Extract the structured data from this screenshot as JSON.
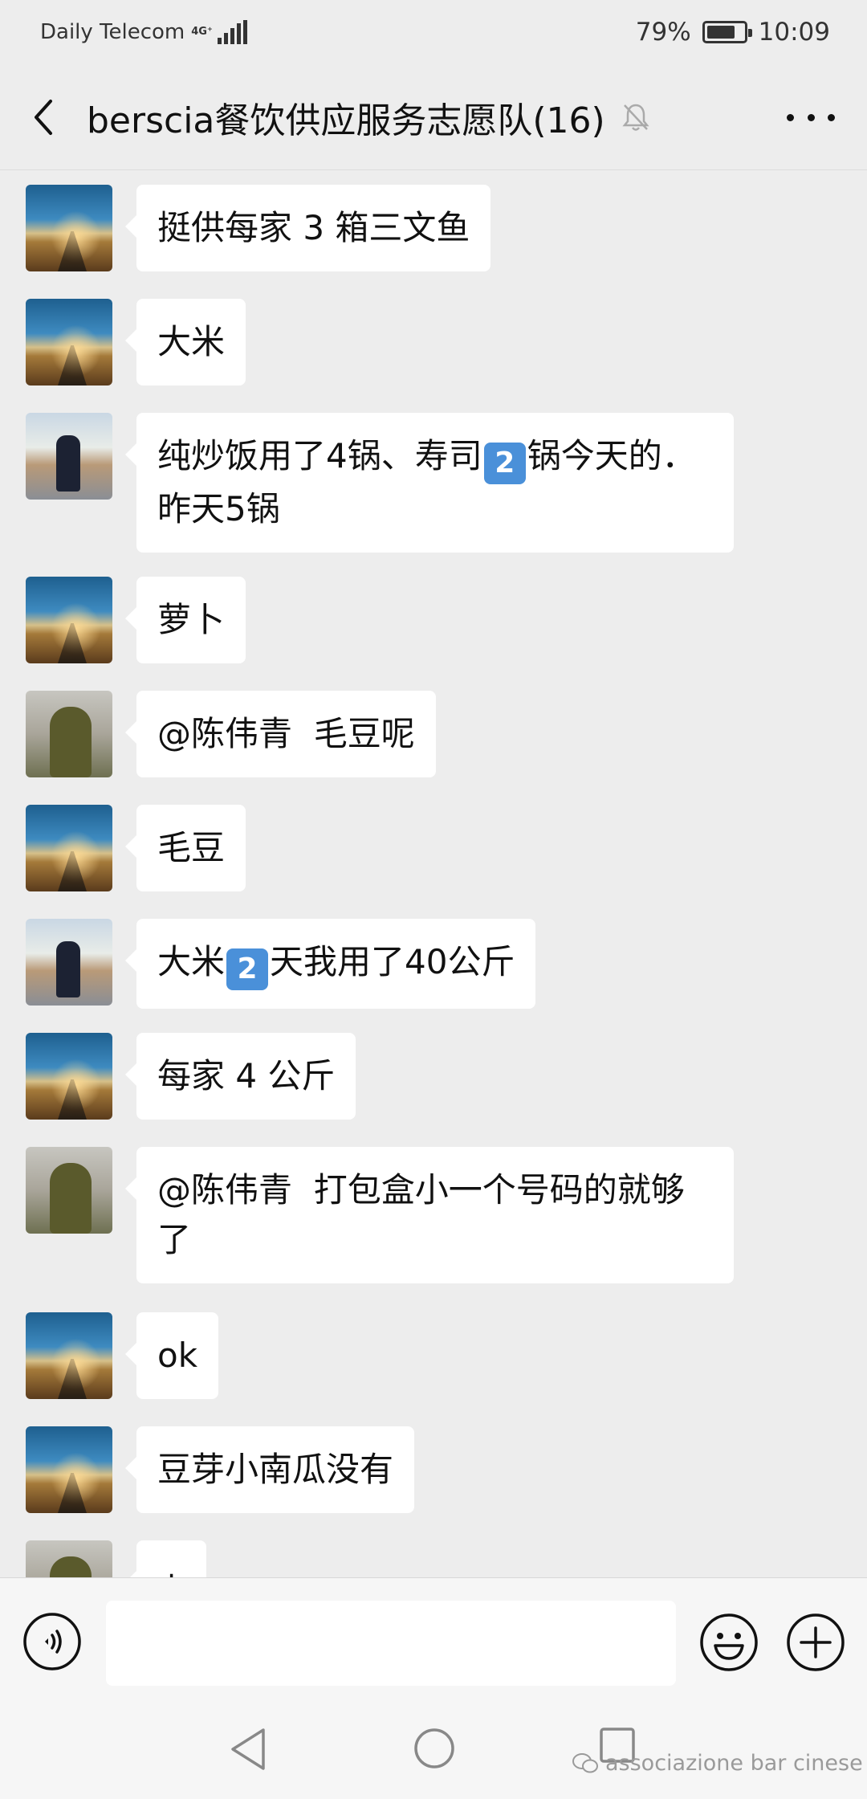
{
  "status_bar": {
    "carrier": "Daily Telecom",
    "network": "4G⁺",
    "battery": "79%",
    "battery_level": 0.79,
    "time": "10:09"
  },
  "header": {
    "title": "berscia餐饮供应服务志愿队(16)"
  },
  "messages": [
    {
      "avatar": "road-landscape",
      "text": "挺供每家 3 箱三文鱼"
    },
    {
      "avatar": "road-landscape",
      "text": "大米"
    },
    {
      "avatar": "man-photo",
      "text_before": "纯炒饭用了4锅、寿司",
      "keycap": "2",
      "text_after": "锅今天的．昨天5锅"
    },
    {
      "avatar": "road-landscape",
      "text": "萝卜"
    },
    {
      "avatar": "child-photo",
      "text": "@陈伟青  毛豆呢"
    },
    {
      "avatar": "road-landscape",
      "text": "毛豆"
    },
    {
      "avatar": "man-photo",
      "text_before": "大米",
      "keycap": "2",
      "text_after": "天我用了40公斤"
    },
    {
      "avatar": "road-landscape",
      "text": "每家 4 公斤"
    },
    {
      "avatar": "child-photo",
      "text": "@陈伟青  打包盒小一个号码的就够了"
    },
    {
      "avatar": "road-landscape",
      "text": "ok"
    },
    {
      "avatar": "road-landscape",
      "text": "豆芽小南瓜没有"
    },
    {
      "avatar": "child-photo",
      "text": "+"
    }
  ],
  "input": {
    "value": ""
  },
  "watermark": "associazione bar cinese",
  "colors": {
    "background": "#ededed",
    "bubble": "#ffffff",
    "keycap": "#4a90d9"
  }
}
